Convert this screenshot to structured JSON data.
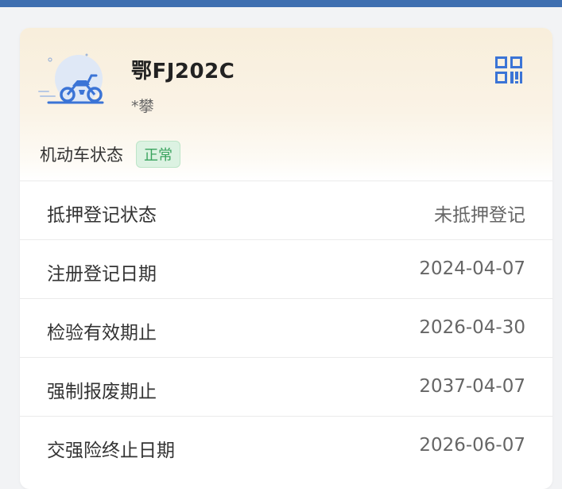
{
  "colors": {
    "top_bar": "#3f6fb0",
    "accent": "#3b74d6",
    "status_green": "#3aa35e"
  },
  "vehicle": {
    "plate": "鄂FJ202C",
    "owner": "*攀",
    "icon": "motorcycle-icon",
    "qr_icon": "qr-code-icon"
  },
  "status": {
    "label": "机动车状态",
    "badge": "正常"
  },
  "details": [
    {
      "label": "抵押登记状态",
      "value": "未抵押登记"
    },
    {
      "label": "注册登记日期",
      "value": "2024-04-07"
    },
    {
      "label": "检验有效期止",
      "value": "2026-04-30"
    },
    {
      "label": "强制报废期止",
      "value": "2037-04-07"
    },
    {
      "label": "交强险终止日期",
      "value": "2026-06-07"
    }
  ]
}
